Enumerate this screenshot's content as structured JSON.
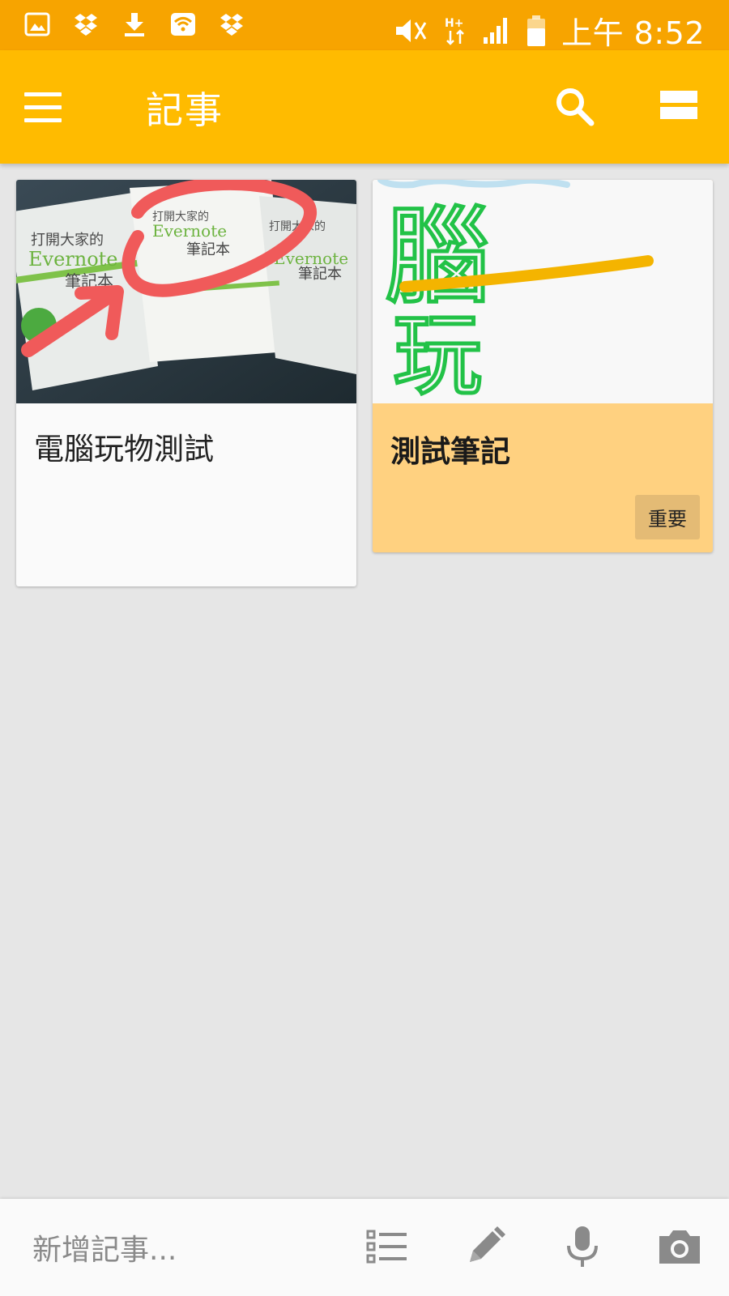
{
  "status_bar": {
    "time": "上午 8:52",
    "left_icons": [
      "gallery-icon",
      "dropbox-icon",
      "download-icon",
      "wifi-icon",
      "dropbox-icon"
    ],
    "right_icons": [
      "mute-icon",
      "hplus-data-icon",
      "signal-icon",
      "battery-icon"
    ]
  },
  "app_bar": {
    "title": "記事",
    "icons": [
      "menu-icon",
      "search-icon",
      "layout-toggle-icon"
    ]
  },
  "notes": [
    {
      "title": "電腦玩物測試",
      "image": "photo-of-evernote-books-with-red-annotation",
      "background": "#fafafa",
      "image_text": [
        "打開大家的",
        "Evernote",
        "筆記本"
      ]
    },
    {
      "title": "測試筆記",
      "image": "green-handwriting-drawing",
      "background": "#ffd180",
      "label": "重要",
      "drawing_text": [
        "腦",
        "玩"
      ]
    }
  ],
  "bottom_bar": {
    "placeholder": "新增記事...",
    "icons": [
      "checklist-icon",
      "pen-icon",
      "mic-icon",
      "camera-icon"
    ]
  },
  "colors": {
    "status_bar": "#f7a400",
    "app_bar": "#ffbb00",
    "background": "#e6e6e6",
    "note_yellow": "#ffd180"
  }
}
